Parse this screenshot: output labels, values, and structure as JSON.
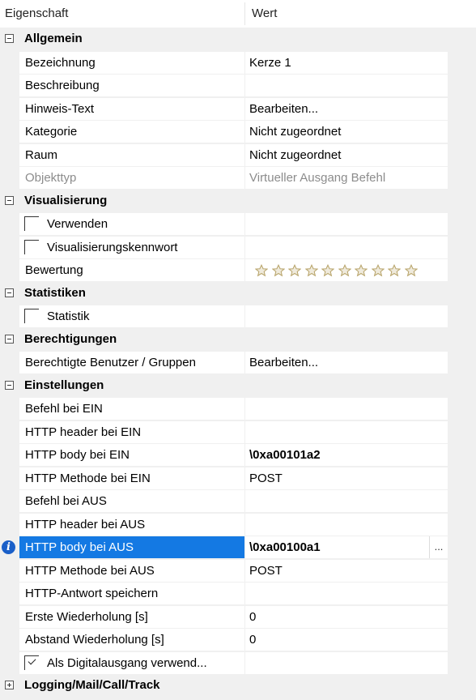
{
  "header": {
    "col_property": "Eigenschaft",
    "col_value": "Wert"
  },
  "categories": {
    "general": "Allgemein",
    "visualization": "Visualisierung",
    "statistics": "Statistiken",
    "permissions": "Berechtigungen",
    "settings": "Einstellungen",
    "logging": "Logging/Mail/Call/Track"
  },
  "general": {
    "name_label": "Bezeichnung",
    "name_value": "Kerze 1",
    "desc_label": "Beschreibung",
    "desc_value": "",
    "hint_label": "Hinweis-Text",
    "hint_value": "Bearbeiten...",
    "category_label": "Kategorie",
    "category_value": "Nicht zugeordnet",
    "room_label": "Raum",
    "room_value": "Nicht zugeordnet",
    "objtype_label": "Objekttyp",
    "objtype_value": "Virtueller Ausgang Befehl"
  },
  "visualization": {
    "use_label": "Verwenden",
    "use_checked": false,
    "password_label": "Visualisierungskennwort",
    "password_checked": false,
    "rating_label": "Bewertung",
    "rating_stars_total": 10,
    "rating_value": 0
  },
  "statistics": {
    "stat_label": "Statistik",
    "stat_checked": false
  },
  "permissions": {
    "users_label": "Berechtigte Benutzer / Gruppen",
    "users_value": "Bearbeiten..."
  },
  "settings": {
    "cmd_on_label": "Befehl bei EIN",
    "cmd_on_value": "",
    "header_on_label": "HTTP header bei EIN",
    "header_on_value": "",
    "body_on_label": "HTTP body bei EIN",
    "body_on_value": "\\0xa00101a2",
    "method_on_label": "HTTP Methode bei EIN",
    "method_on_value": "POST",
    "cmd_off_label": "Befehl bei AUS",
    "cmd_off_value": "",
    "header_off_label": "HTTP header bei AUS",
    "header_off_value": "",
    "body_off_label": "HTTP body bei AUS",
    "body_off_value": "\\0xa00100a1",
    "ellipsis": "...",
    "method_off_label": "HTTP Methode bei AUS",
    "method_off_value": "POST",
    "save_resp_label": "HTTP-Antwort speichern",
    "save_resp_value": "",
    "first_rep_label": "Erste Wiederholung [s]",
    "first_rep_value": "0",
    "interval_rep_label": "Abstand Wiederholung [s]",
    "interval_rep_value": "0",
    "digital_label": "Als Digitalausgang verwend...",
    "digital_checked": true
  },
  "info_icon_glyph": "i",
  "colors": {
    "selection": "#1479e3",
    "info_icon": "#1a5fc8",
    "star": "#b8a46a"
  }
}
